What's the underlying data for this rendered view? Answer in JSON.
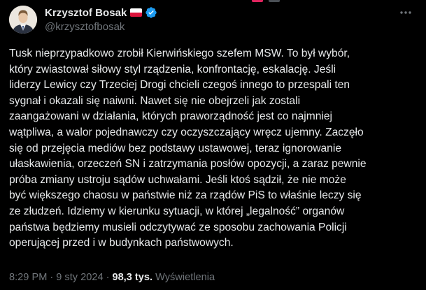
{
  "author": {
    "display_name": "Krzysztof Bosak",
    "handle": "@krzysztofbosak",
    "flag_icon": "poland-flag-icon",
    "verified_icon": "verified-badge-icon",
    "verified_color": "#1d9bf0"
  },
  "menu": {
    "icon": "more-options-icon"
  },
  "tweet": {
    "text": "Tusk nieprzypadkowo zrobił Kierwińskiego szefem MSW. To był wybór,\nktóry zwiastował siłowy styl rządzenia, konfrontację, eskalację. Jeśli\nliderzy Lewicy czy Trzeciej Drogi chcieli czegoś innego to przespali ten\nsygnał i okazali się naiwni. Nawet się nie obejrzeli jak zostali\nzaangażowani w działania, których praworządność jest co najmniej\nwątpliwa, a walor pojednawczy czy oczyszczający wręcz ujemny. Zaczęło\nsię od przejęcia mediów bez podstawy ustawowej, teraz ignorowanie\nułaskawienia, orzeczeń SN i zatrzymania posłów opozycji, a zaraz pewnie\npróba zmiany ustroju sądów uchwałami. Jeśli ktoś sądził, że nie może\nbyć większego chaosu w państwie niż za rządów PiS to właśnie leczy się\nze złudzeń. Idziemy w kierunku sytuacji, w której „legalność” organów\npaństwa będziemy musieli odczytywać ze sposobu zachowania Policji\noperującej przed i w budynkach państwowych."
  },
  "meta": {
    "time": "8:29 PM",
    "separator": "·",
    "date": "9 sty 2024",
    "views_count": "98,3 tys.",
    "views_label": "Wyświetlenia"
  }
}
